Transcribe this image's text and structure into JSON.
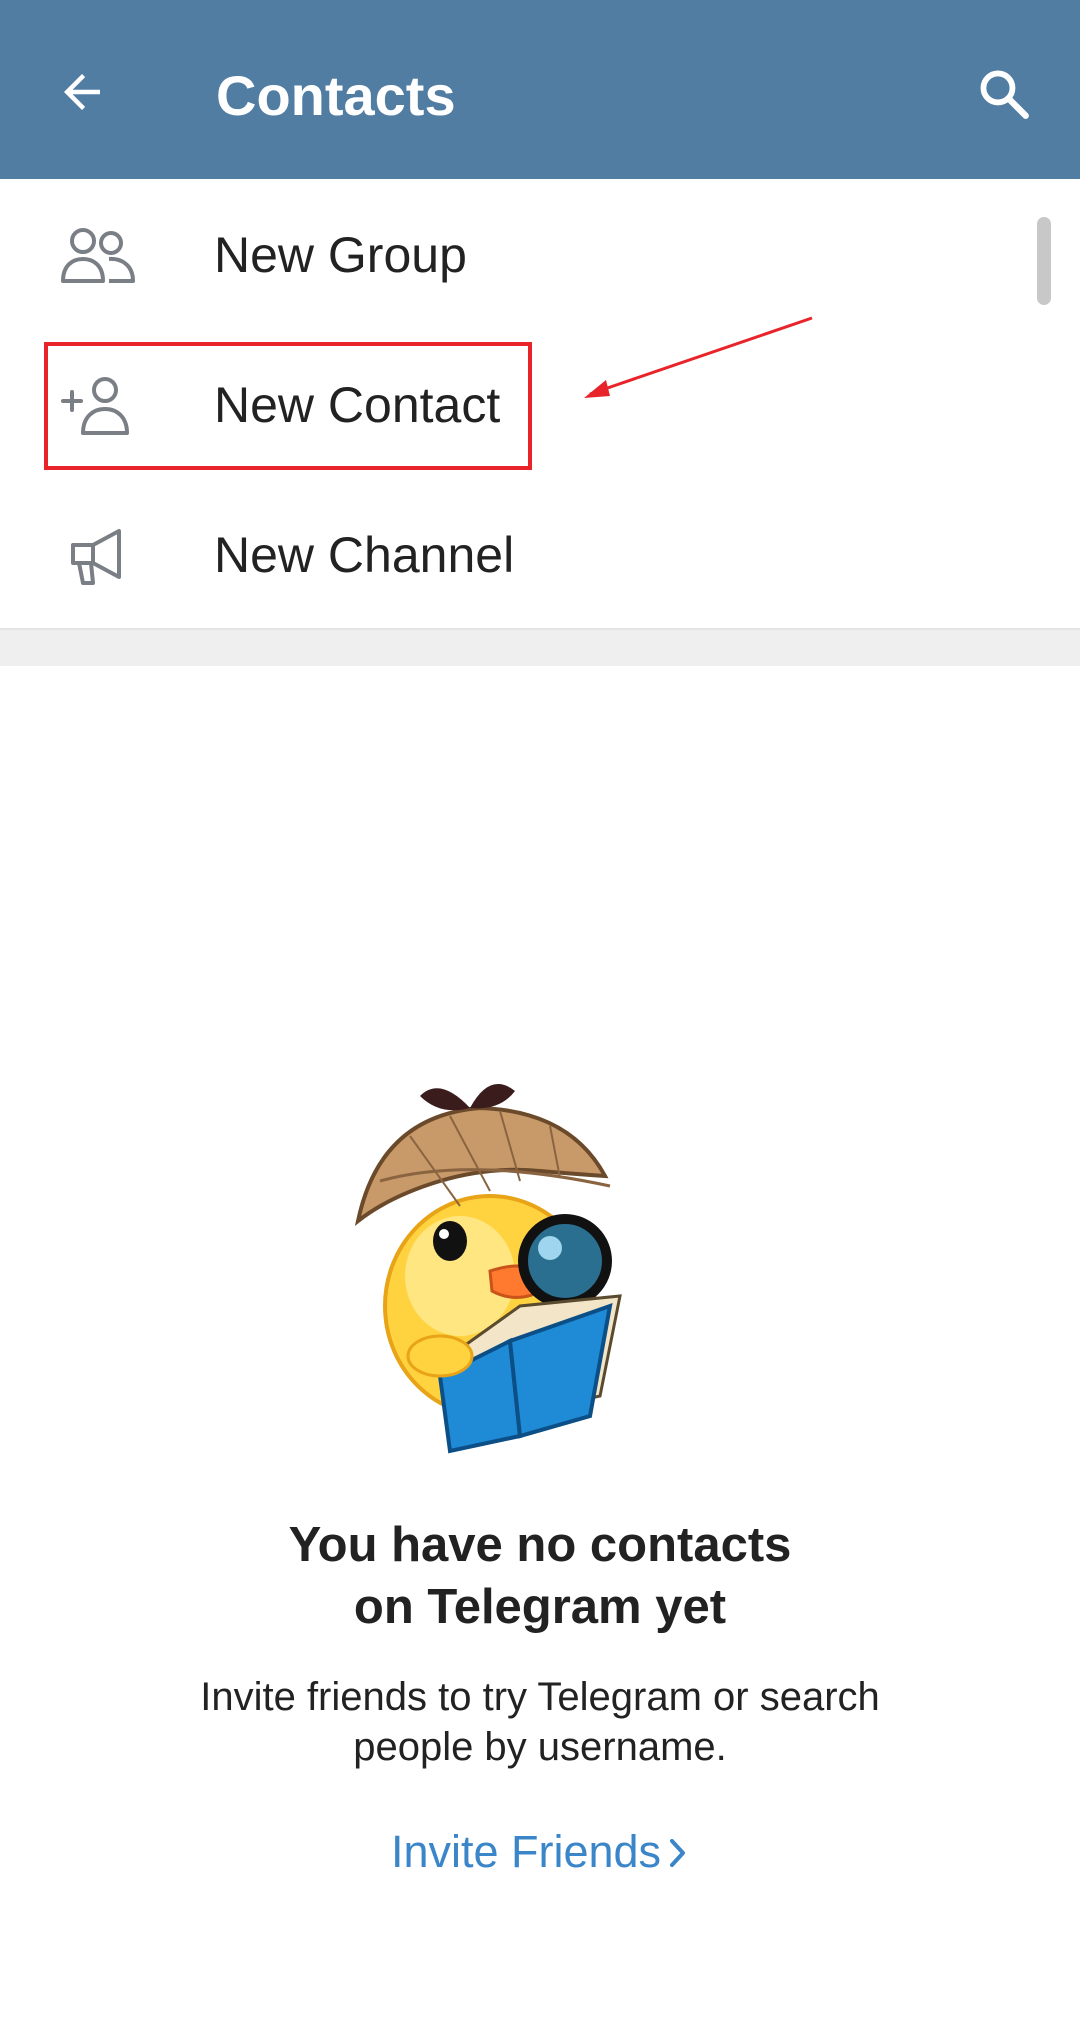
{
  "header": {
    "title": "Contacts",
    "back_icon": "back-arrow-icon",
    "search_icon": "search-icon",
    "background_color": "#527DA3"
  },
  "menu": {
    "items": [
      {
        "label": "New Group",
        "icon": "group-icon"
      },
      {
        "label": "New Contact",
        "icon": "add-contact-icon"
      },
      {
        "label": "New Channel",
        "icon": "megaphone-icon"
      }
    ]
  },
  "empty_state": {
    "title_line1": "You have no contacts",
    "title_line2": "on Telegram yet",
    "subtitle_line1": "Invite friends to try Telegram or search",
    "subtitle_line2": "people by username.",
    "invite_label": "Invite Friends",
    "invite_icon": "chevron-right-icon",
    "link_color": "#3a86c8",
    "sticker": "detective-duck-sticker"
  },
  "annotation": {
    "highlight_color": "#e8232a"
  }
}
